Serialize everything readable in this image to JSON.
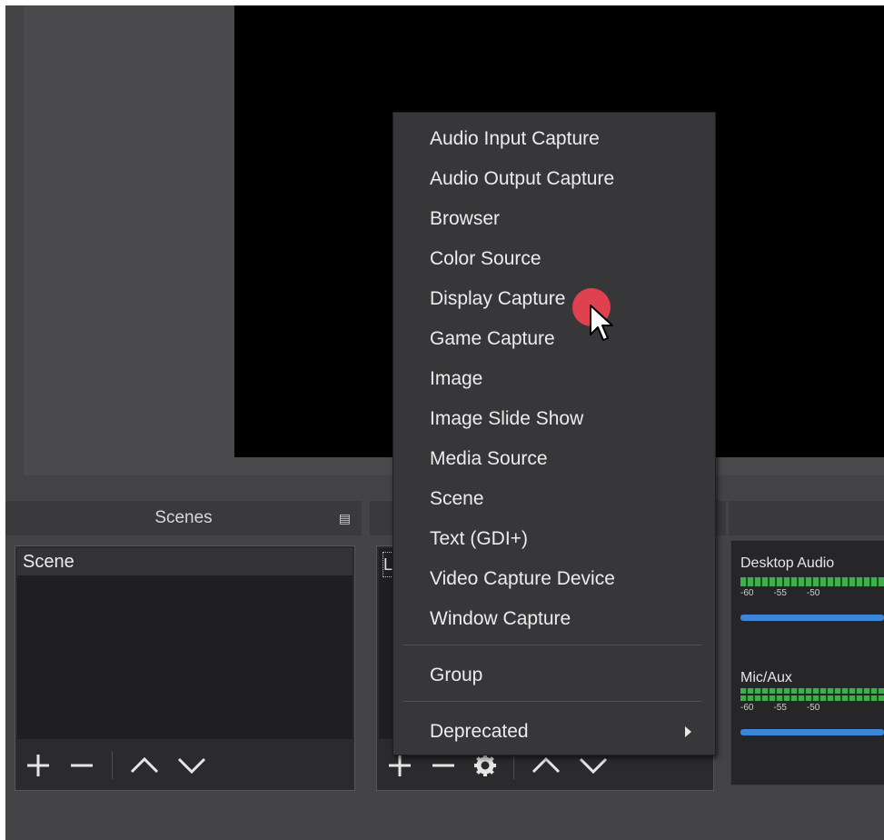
{
  "scenes_dock": {
    "title": "Scenes",
    "items": [
      "Scene"
    ]
  },
  "sources_dock": {
    "partial_item": "L"
  },
  "mixer": {
    "channels": [
      {
        "name": "Desktop Audio",
        "scale": [
          "-60",
          "-55",
          "-50"
        ]
      },
      {
        "name": "Mic/Aux",
        "scale": [
          "-60",
          "-55",
          "-50"
        ]
      }
    ]
  },
  "context_menu": {
    "items": [
      "Audio Input Capture",
      "Audio Output Capture",
      "Browser",
      "Color Source",
      "Display Capture",
      "Game Capture",
      "Image",
      "Image Slide Show",
      "Media Source",
      "Scene",
      "Text (GDI+)",
      "Video Capture Device",
      "Window Capture"
    ],
    "group": "Group",
    "deprecated": "Deprecated"
  },
  "colors": {
    "background": "#444446",
    "preview": "#000000",
    "menu": "#373739",
    "meter_green": "#3bb04a",
    "volume_blue": "#3b86d8",
    "click_indicator": "#e8424f"
  },
  "icons": [
    "float-dock-icon",
    "plus-icon",
    "minus-icon",
    "gear-icon",
    "chevron-up-icon",
    "chevron-down-icon",
    "submenu-arrow-icon",
    "mouse-cursor-icon"
  ]
}
